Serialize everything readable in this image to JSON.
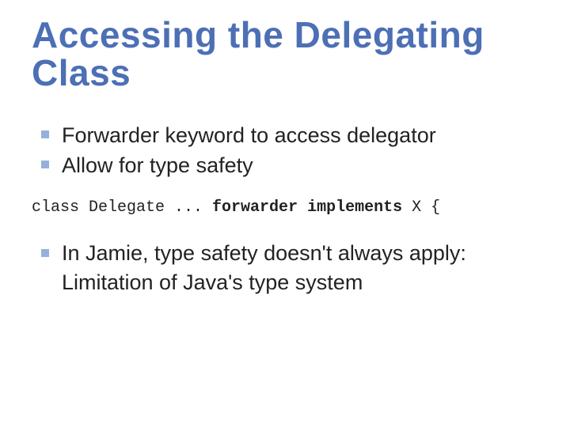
{
  "title": "Accessing the Delegating Class",
  "bullets_a": [
    "Forwarder keyword to access delegator",
    "Allow for type safety"
  ],
  "code": {
    "t1": "class Delegate ... ",
    "kw1": "forwarder",
    "t2": " ",
    "kw2": "implements",
    "t3": " X {"
  },
  "bullets_b": [
    "In Jamie, type safety doesn't always apply: Limitation of Java's type system"
  ]
}
